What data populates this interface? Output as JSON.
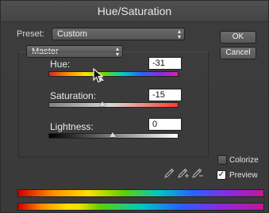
{
  "window": {
    "title": "Hue/Saturation"
  },
  "preset": {
    "label": "Preset:",
    "value": "Custom"
  },
  "channel": {
    "value": "Master"
  },
  "buttons": {
    "ok": "OK",
    "cancel": "Cancel"
  },
  "hue": {
    "label": "Hue:",
    "value": "-31",
    "level_percent": 41
  },
  "saturation": {
    "label": "Saturation:",
    "value": "-15",
    "level_percent": 42
  },
  "lightness": {
    "label": "Lightness:",
    "value": "0",
    "level_percent": 50
  },
  "options": {
    "colorize": {
      "label": "Colorize",
      "checked": false
    },
    "preview": {
      "label": "Preview",
      "checked": true
    }
  },
  "icons": [
    "eyedropper-icon",
    "eyedropper-plus-icon",
    "eyedropper-minus-icon",
    "mouse-pointer-icon",
    "select-arrows-icon",
    "checkmark-icon"
  ]
}
